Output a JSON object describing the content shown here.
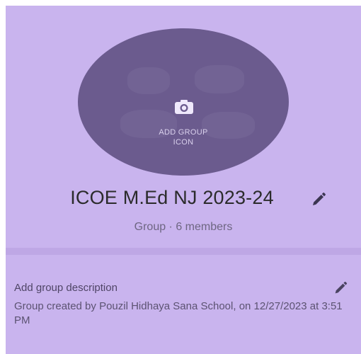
{
  "group_icon": {
    "label_line1": "ADD GROUP",
    "label_line2": "ICON",
    "icon": "camera-icon"
  },
  "group": {
    "name": "ICOE M.Ed NJ 2023-24",
    "meta": "Group · 6 members",
    "edit_icon": "pencil-icon"
  },
  "description": {
    "add_label": "Add group description",
    "created_text": "Group created by Pouzil Hidhaya Sana School, on 12/27/2023 at 3:51 PM",
    "edit_icon": "pencil-icon"
  },
  "colors": {
    "background": "#c9b4ee",
    "icon_circle": "#6b5b8e",
    "divider": "#bea7e5"
  }
}
